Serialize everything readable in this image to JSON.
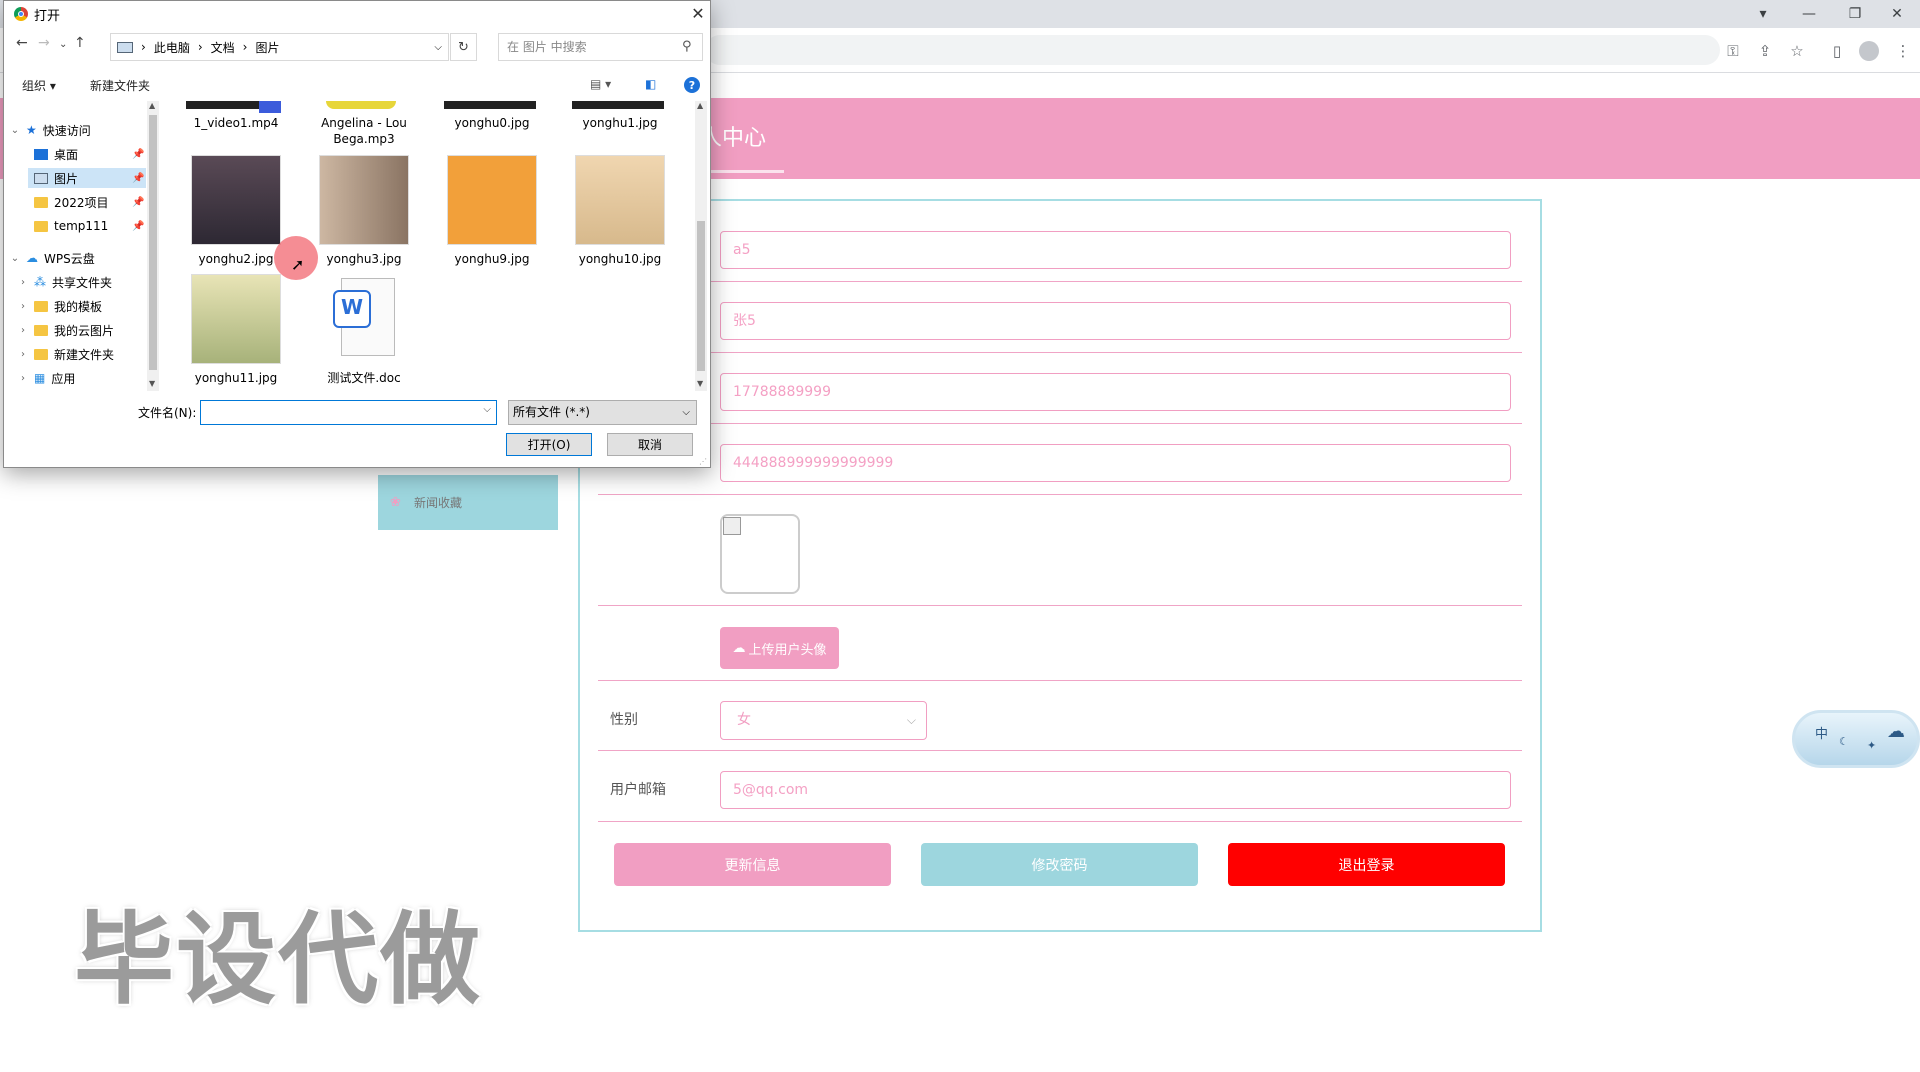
{
  "browser": {
    "window_controls": [
      "▾",
      "—",
      "❐",
      "✕"
    ],
    "toolbar_icons": [
      "key-icon",
      "share-icon",
      "star-icon",
      "sidepanel-icon",
      "profile-icon",
      "menu-icon"
    ]
  },
  "page": {
    "title": "人中心",
    "side_menu": {
      "item": "新闻收藏"
    },
    "form": {
      "username": "a5",
      "name": "张5",
      "phone": "17788889999",
      "id_number": "444888999999999999",
      "upload_button": "上传用户头像",
      "gender": {
        "label": "性别",
        "selected": "女"
      },
      "email": {
        "label": "用户邮箱",
        "value": "5@qq.com"
      },
      "buttons": {
        "update": "更新信息",
        "change_password": "修改密码",
        "logout": "退出登录"
      }
    },
    "watermark": "毕设代做",
    "float_widget": {
      "text": "中"
    },
    "colors": {
      "brand_pink": "#f19ec2",
      "teal": "#9dd6de",
      "logout_red": "#ff0000"
    }
  },
  "dialog": {
    "title": "打开",
    "breadcrumb": [
      "此电脑",
      "文档",
      "图片"
    ],
    "search_placeholder": "在 图片 中搜索",
    "commands": {
      "organize": "组织 ▾",
      "new_folder": "新建文件夹"
    },
    "nav": [
      {
        "label": "快速访问",
        "type": "star",
        "level": 0,
        "expanded": true
      },
      {
        "label": "桌面",
        "type": "desktop",
        "level": 1,
        "pinned": true
      },
      {
        "label": "图片",
        "type": "pictures",
        "level": 1,
        "pinned": true,
        "selected": true
      },
      {
        "label": "2022项目",
        "type": "folder",
        "level": 1,
        "pinned": true
      },
      {
        "label": "temp111",
        "type": "folder",
        "level": 1,
        "pinned": true
      },
      {
        "label": "WPS云盘",
        "type": "cloud",
        "level": 0,
        "expanded": true
      },
      {
        "label": "共享文件夹",
        "type": "share",
        "level": 1
      },
      {
        "label": "我的模板",
        "type": "folder",
        "level": 1
      },
      {
        "label": "我的云图片",
        "type": "folder",
        "level": 1
      },
      {
        "label": "新建文件夹",
        "type": "folder",
        "level": 1
      },
      {
        "label": "应用",
        "type": "apps",
        "level": 1
      }
    ],
    "files_top_row": [
      "1_video1.mp4",
      "Angelina - Lou Bega.mp3",
      "yonghu0.jpg",
      "yonghu1.jpg"
    ],
    "files": [
      {
        "name": "yonghu2.jpg",
        "thumb": "#3a3a48"
      },
      {
        "name": "yonghu3.jpg",
        "thumb": "#b09a86"
      },
      {
        "name": "yonghu9.jpg",
        "thumb": "#f2a03a"
      },
      {
        "name": "yonghu10.jpg",
        "thumb": "#e9cba5"
      },
      {
        "name": "yonghu11.jpg",
        "thumb": "#c7c28e"
      },
      {
        "name": "测试文件.doc",
        "thumb": "doc"
      }
    ],
    "filename_label": "文件名(N):",
    "filename_value": "",
    "filetype": "所有文件 (*.*)",
    "open_button": "打开(O)",
    "cancel_button": "取消"
  }
}
